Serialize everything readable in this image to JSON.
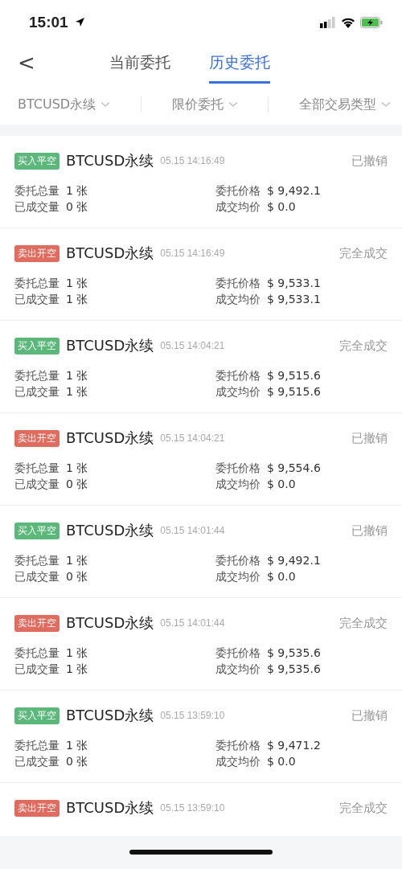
{
  "status_bar": {
    "time": "15:01"
  },
  "nav": {
    "back": "<",
    "tabs": [
      {
        "label": "当前委托",
        "selected": false
      },
      {
        "label": "历史委托",
        "selected": true
      }
    ]
  },
  "filters": [
    {
      "label": "BTCUSD永续"
    },
    {
      "label": "限价委托"
    },
    {
      "label": "全部交易类型"
    }
  ],
  "orders": [
    {
      "tag": "买入平空",
      "kind": "buy",
      "symbol": "BTCUSD永续",
      "time": "05.15 14:16:49",
      "status": "已撤销",
      "fields": [
        {
          "label": "委托总量",
          "value": "1 张"
        },
        {
          "label": "委托价格",
          "value": "$ 9,492.1"
        },
        {
          "label": "已成交量",
          "value": "0 张"
        },
        {
          "label": "成交均价",
          "value": "$ 0.0"
        }
      ]
    },
    {
      "tag": "卖出开空",
      "kind": "sell",
      "symbol": "BTCUSD永续",
      "time": "05.15 14:16:49",
      "status": "完全成交",
      "fields": [
        {
          "label": "委托总量",
          "value": "1 张"
        },
        {
          "label": "委托价格",
          "value": "$ 9,533.1"
        },
        {
          "label": "已成交量",
          "value": "1 张"
        },
        {
          "label": "成交均价",
          "value": "$ 9,533.1"
        }
      ]
    },
    {
      "tag": "买入平空",
      "kind": "buy",
      "symbol": "BTCUSD永续",
      "time": "05.15 14:04:21",
      "status": "完全成交",
      "fields": [
        {
          "label": "委托总量",
          "value": "1 张"
        },
        {
          "label": "委托价格",
          "value": "$ 9,515.6"
        },
        {
          "label": "已成交量",
          "value": "1 张"
        },
        {
          "label": "成交均价",
          "value": "$ 9,515.6"
        }
      ]
    },
    {
      "tag": "卖出开空",
      "kind": "sell",
      "symbol": "BTCUSD永续",
      "time": "05.15 14:04:21",
      "status": "已撤销",
      "fields": [
        {
          "label": "委托总量",
          "value": "1 张"
        },
        {
          "label": "委托价格",
          "value": "$ 9,554.6"
        },
        {
          "label": "已成交量",
          "value": "0 张"
        },
        {
          "label": "成交均价",
          "value": "$ 0.0"
        }
      ]
    },
    {
      "tag": "买入平空",
      "kind": "buy",
      "symbol": "BTCUSD永续",
      "time": "05.15 14:01:44",
      "status": "已撤销",
      "fields": [
        {
          "label": "委托总量",
          "value": "1 张"
        },
        {
          "label": "委托价格",
          "value": "$ 9,492.1"
        },
        {
          "label": "已成交量",
          "value": "0 张"
        },
        {
          "label": "成交均价",
          "value": "$ 0.0"
        }
      ]
    },
    {
      "tag": "卖出开空",
      "kind": "sell",
      "symbol": "BTCUSD永续",
      "time": "05.15 14:01:44",
      "status": "完全成交",
      "fields": [
        {
          "label": "委托总量",
          "value": "1 张"
        },
        {
          "label": "委托价格",
          "value": "$ 9,535.6"
        },
        {
          "label": "已成交量",
          "value": "1 张"
        },
        {
          "label": "成交均价",
          "value": "$ 9,535.6"
        }
      ]
    },
    {
      "tag": "买入平空",
      "kind": "buy",
      "symbol": "BTCUSD永续",
      "time": "05.15 13:59:10",
      "status": "已撤销",
      "fields": [
        {
          "label": "委托总量",
          "value": "1 张"
        },
        {
          "label": "委托价格",
          "value": "$ 9,471.2"
        },
        {
          "label": "已成交量",
          "value": "0 张"
        },
        {
          "label": "成交均价",
          "value": "$ 0.0"
        }
      ]
    },
    {
      "tag": "卖出开空",
      "kind": "sell",
      "symbol": "BTCUSD永续",
      "time": "05.15 13:59:10",
      "status": "完全成交"
    }
  ]
}
